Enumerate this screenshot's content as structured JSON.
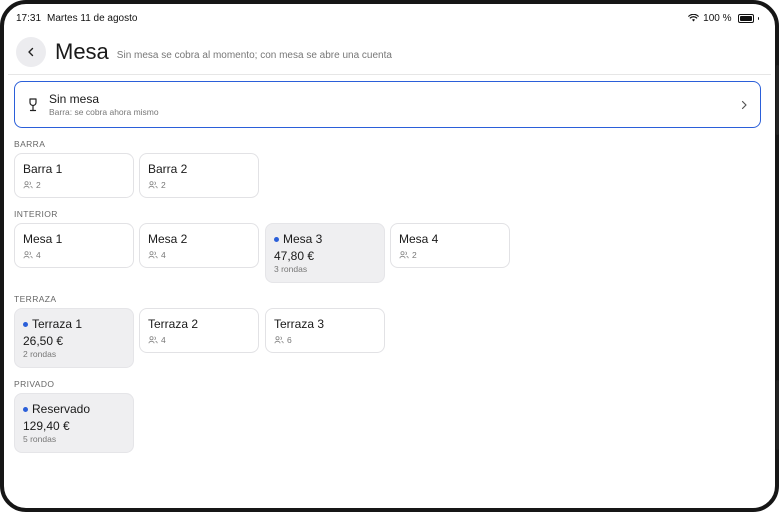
{
  "status": {
    "time": "17:31",
    "date": "Martes 11 de agosto",
    "battery": "100 %",
    "icons": [
      "wifi-icon",
      "battery-icon"
    ]
  },
  "header": {
    "title": "Mesa",
    "subtitle": "Sin mesa se cobra al momento; con mesa se abre una cuenta",
    "back_icon": "chevron-left-icon"
  },
  "no_table": {
    "label": "Sin mesa",
    "sub": "Barra: se cobra ahora mismo",
    "icon": "wine-glass-icon",
    "accent": "#2b5fd9"
  },
  "sections": [
    {
      "title": "BARRA",
      "tables": [
        {
          "name": "Barra 1",
          "seats": "2"
        },
        {
          "name": "Barra 2",
          "seats": "2"
        }
      ]
    },
    {
      "title": "INTERIOR",
      "tables": [
        {
          "name": "Mesa 1",
          "seats": "4"
        },
        {
          "name": "Mesa 2",
          "seats": "4"
        },
        {
          "name": "Mesa 3",
          "amount": "47,80 €",
          "rounds": "3 rondas"
        },
        {
          "name": "Mesa 4",
          "seats": "2"
        }
      ]
    },
    {
      "title": "TERRAZA",
      "tables": [
        {
          "name": "Terraza 1",
          "amount": "26,50 €",
          "rounds": "2 rondas"
        },
        {
          "name": "Terraza 2",
          "seats": "4"
        },
        {
          "name": "Terraza 3",
          "seats": "6"
        }
      ]
    },
    {
      "title": "PRIVADO",
      "tables": [
        {
          "name": "Reservado",
          "amount": "129,40 €",
          "rounds": "5 rondas"
        }
      ]
    }
  ]
}
